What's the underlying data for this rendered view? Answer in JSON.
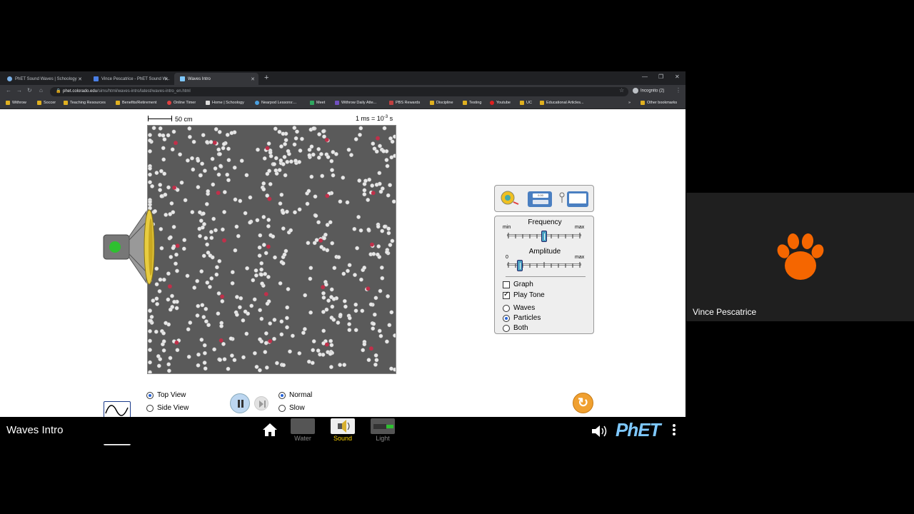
{
  "browser": {
    "tabs": [
      {
        "title": "PhET Sound Waves | Schoology",
        "active": false
      },
      {
        "title": "Vince Pescatrice - PhET Sound W...",
        "active": false
      },
      {
        "title": "Waves Intro",
        "active": true
      }
    ],
    "url_host": "phet.colorado.edu",
    "url_path": "/sims/html/waves-intro/latest/waves-intro_en.html",
    "profile_label": "Incognito (2)",
    "bookmarks": [
      "Withrow",
      "Soccer",
      "Teaching Resources",
      "Benefits/Retirement",
      "Online Timer",
      "Home | Schoology",
      "Nearpod Lessons:...",
      "Meet",
      "Withrow Daily Atte...",
      "PBS Rewards",
      "Discipline",
      "Testing",
      "Youtube",
      "UC",
      "Educational Articles..."
    ],
    "other_bookmarks": "Other bookmarks"
  },
  "sim": {
    "scale_label": "50 cm",
    "time_label_prefix": "1 ms = 10",
    "time_label_exp": "-3",
    "time_label_suffix": " s",
    "controls": {
      "frequency_title": "Frequency",
      "frequency_min": "min",
      "frequency_max": "max",
      "frequency_value": 0.5,
      "amplitude_title": "Amplitude",
      "amplitude_min": "0",
      "amplitude_max": "max",
      "amplitude_value": 0.17,
      "graph_label": "Graph",
      "graph_checked": false,
      "play_tone_label": "Play Tone",
      "play_tone_checked": true,
      "view_options": [
        "Waves",
        "Particles",
        "Both"
      ],
      "view_selected": "Particles"
    },
    "bottom": {
      "top_view": "Top View",
      "side_view": "Side View",
      "normal": "Normal",
      "slow": "Slow",
      "view_selected": "Top View",
      "speed_selected": "Normal"
    }
  },
  "navbar": {
    "title": "Waves Intro",
    "screens": [
      {
        "label": "Water",
        "active": false
      },
      {
        "label": "Sound",
        "active": true
      },
      {
        "label": "Light",
        "active": false
      }
    ],
    "logo": "PhET"
  },
  "video": {
    "participant_name": "Vince Pescatrice"
  },
  "colors": {
    "particle": "#e8e8e8",
    "particle_marked": "#c0304a",
    "box_bg": "#5a5a5a",
    "accent_blue": "#2563d9",
    "reset_orange": "#f0a030",
    "clemson_orange": "#f56600"
  }
}
